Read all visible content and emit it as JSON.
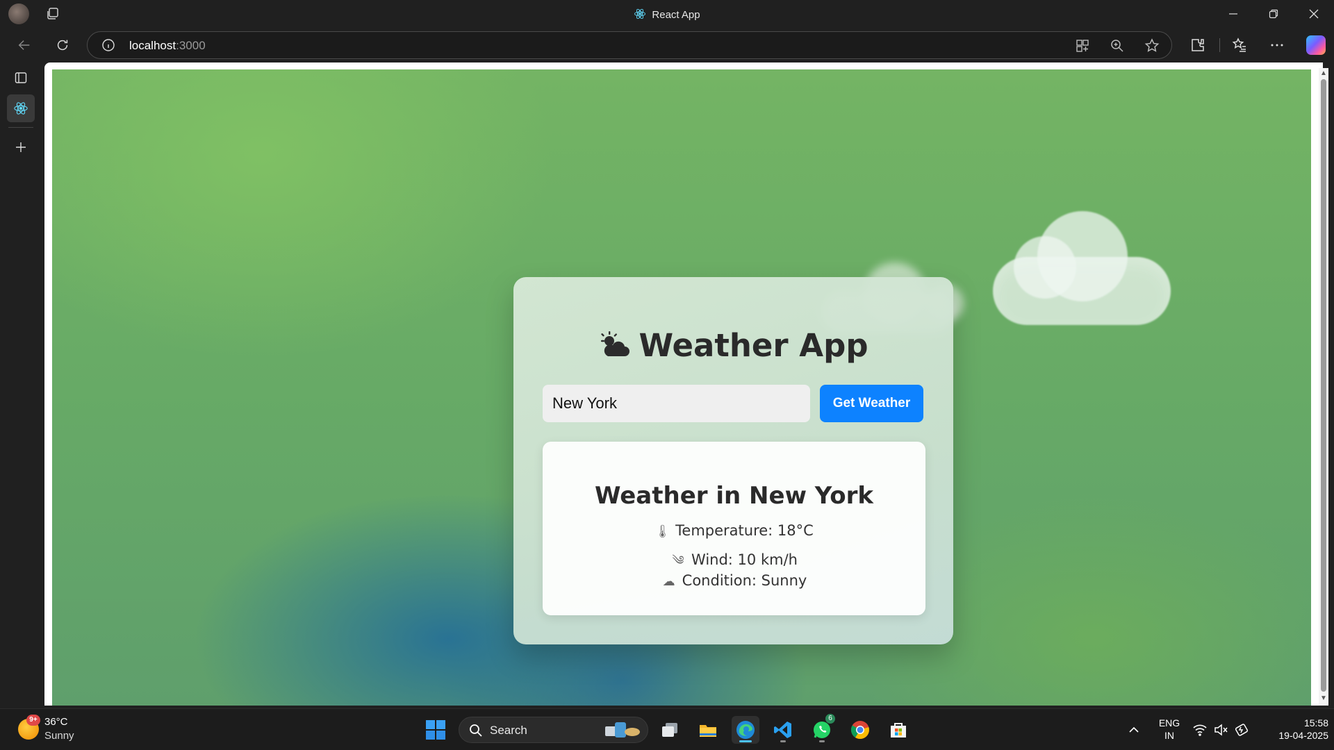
{
  "window": {
    "title": "React App"
  },
  "browser": {
    "url_host": "localhost",
    "url_port": ":3000"
  },
  "app": {
    "title": "Weather App",
    "title_icon": "sun-behind-cloud-icon",
    "search": {
      "value": "New York"
    },
    "button_label": "Get Weather",
    "result": {
      "title": "Weather in New York",
      "temperature": "Temperature: 18°C",
      "wind": "Wind: 10 km/h",
      "condition": "Condition: Sunny"
    }
  },
  "taskbar": {
    "weather_temp": "36°C",
    "weather_cond": "Sunny",
    "weather_badge": "9+",
    "search_label": "Search",
    "whatsapp_badge": "6",
    "lang_top": "ENG",
    "lang_bottom": "IN",
    "time": "15:58",
    "date": "19-04-2025"
  },
  "colors": {
    "accent": "#0d82ff",
    "background_green": "#6aad62",
    "card": "#d5e7d6"
  }
}
